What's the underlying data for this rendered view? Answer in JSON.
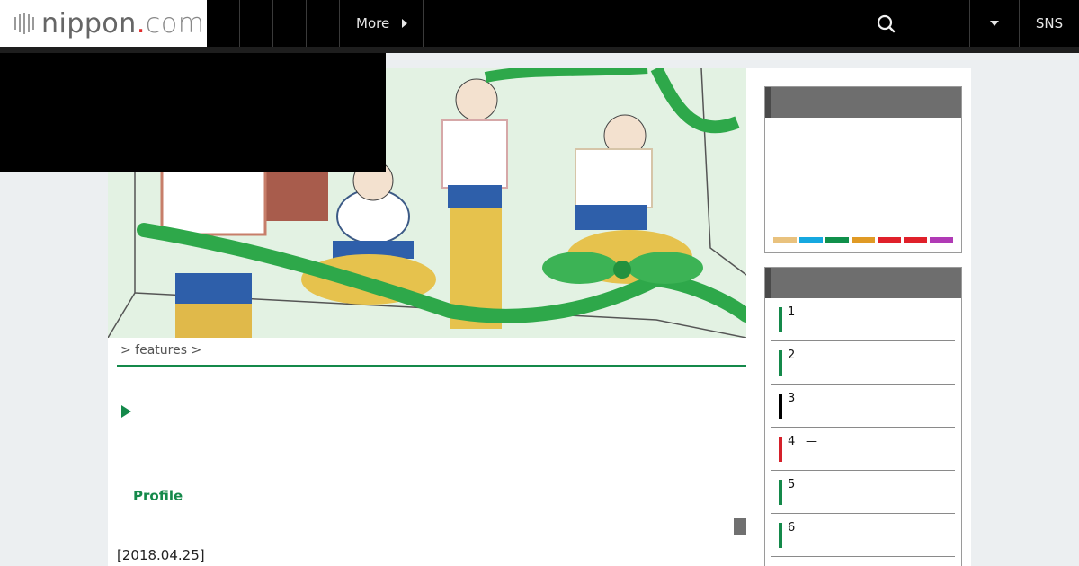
{
  "header": {
    "logo": {
      "name": "nippon",
      "dot": ".",
      "tld": "com"
    },
    "nav": {
      "more_label": "More"
    },
    "search_icon": "search-icon",
    "sns_label": "SNS"
  },
  "main": {
    "breadcrumb": "> features >",
    "profile_label": "Profile",
    "date": "[2018.04.25]"
  },
  "sidebar": {
    "palette": [
      "#e9c27e",
      "#16a8e0",
      "#10904b",
      "#e09a25",
      "#e0202a",
      "#e0202a",
      "#b03ab5"
    ],
    "ranking": [
      {
        "num": "1",
        "color": "#14894a",
        "dash": ""
      },
      {
        "num": "2",
        "color": "#14894a",
        "dash": ""
      },
      {
        "num": "3",
        "color": "#000000",
        "dash": ""
      },
      {
        "num": "4",
        "color": "#d5202a",
        "dash": "—"
      },
      {
        "num": "5",
        "color": "#14894a",
        "dash": ""
      },
      {
        "num": "6",
        "color": "#14894a",
        "dash": ""
      }
    ]
  },
  "colors": {
    "accent": "#14894a",
    "header_bg": "#000000"
  }
}
